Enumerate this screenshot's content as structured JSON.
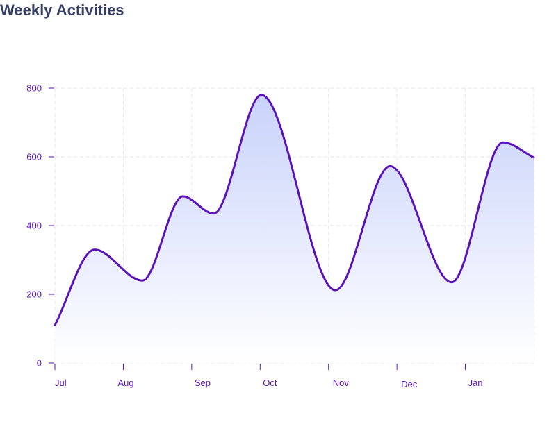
{
  "title": "Weekly Activities",
  "chart_data": {
    "type": "area",
    "title": "Weekly Activities",
    "xlabel": "",
    "ylabel": "",
    "categories": [
      "Jul",
      "Aug",
      "Sep",
      "Oct",
      "Nov",
      "Dec",
      "Jan"
    ],
    "x_extent": [
      0,
      7
    ],
    "ylim": [
      0,
      800
    ],
    "yticks": [
      0,
      200,
      400,
      600,
      800
    ],
    "grid": true,
    "series": [
      {
        "points": [
          {
            "x": 0.0,
            "y": 110
          },
          {
            "x": 0.58,
            "y": 330
          },
          {
            "x": 1.28,
            "y": 240
          },
          {
            "x": 1.87,
            "y": 485
          },
          {
            "x": 2.32,
            "y": 435
          },
          {
            "x": 3.02,
            "y": 780
          },
          {
            "x": 4.1,
            "y": 212
          },
          {
            "x": 4.9,
            "y": 573
          },
          {
            "x": 5.8,
            "y": 235
          },
          {
            "x": 6.55,
            "y": 642
          },
          {
            "x": 7.0,
            "y": 598
          }
        ]
      }
    ],
    "colors": {
      "line": "#5b12b8",
      "fill_top": "#c9d3fb",
      "fill_bottom": "#ffffff",
      "text": "#5b12b8",
      "grid": "#e6e6ea"
    }
  }
}
